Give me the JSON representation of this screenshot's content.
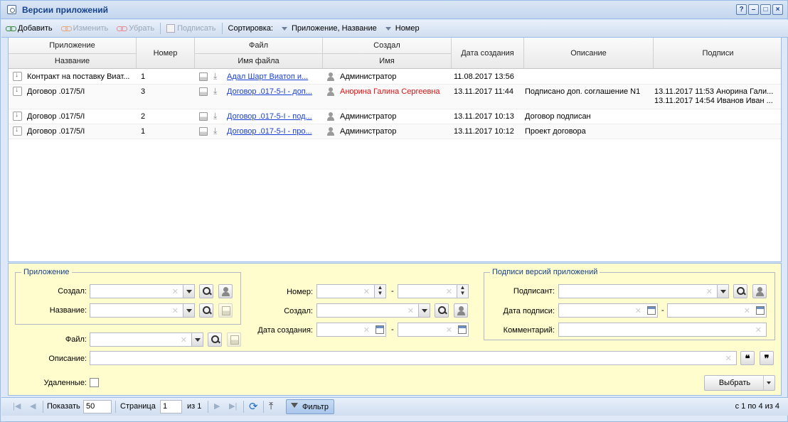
{
  "window": {
    "title": "Версии приложений",
    "controls": [
      "?",
      "–",
      "□",
      "×"
    ]
  },
  "toolbar": {
    "add": "Добавить",
    "edit": "Изменить",
    "remove": "Убрать",
    "sign": "Подписать",
    "sort_label": "Сортировка:",
    "sort1": "Приложение, Название",
    "sort2": "Номер"
  },
  "grid": {
    "headers": {
      "app": "Приложение",
      "app_name": "Название",
      "number": "Номер",
      "file": "Файл",
      "file_name": "Имя файла",
      "creator": "Создал",
      "creator_name": "Имя",
      "created_date": "Дата создания",
      "description": "Описание",
      "signatures": "Подписи"
    },
    "rows": [
      {
        "name": "Контракт на поставку Виат...",
        "number": "1",
        "file": "Адал Шарт Виатоп и...",
        "creator": "Администратор",
        "creator_red": false,
        "date": "11.08.2017 13:56",
        "description": "",
        "sig1": "",
        "sig2": ""
      },
      {
        "name": "Договор .017/5/I",
        "number": "3",
        "file": "Договор .017-5-I - доп...",
        "creator": "Анорина Галина Сергеевна",
        "creator_red": true,
        "date": "13.11.2017 11:44",
        "description": "Подписано доп. соглашение N1",
        "sig1": "13.11.2017 11:53 Анорина Гали...",
        "sig2": "13.11.2017 14:54 Иванов Иван ..."
      },
      {
        "name": "Договор .017/5/I",
        "number": "2",
        "file": "Договор .017-5-I - под...",
        "creator": "Администратор",
        "creator_red": false,
        "date": "13.11.2017 10:13",
        "description": "Договор подписан",
        "sig1": "",
        "sig2": ""
      },
      {
        "name": "Договор .017/5/I",
        "number": "1",
        "file": "Договор .017-5-I - про...",
        "creator": "Администратор",
        "creator_red": false,
        "date": "13.11.2017 10:12",
        "description": "Проект договора",
        "sig1": "",
        "sig2": ""
      }
    ]
  },
  "filter": {
    "app_group": "Приложение",
    "created_by": "Создал:",
    "name": "Название:",
    "file": "Файл:",
    "description": "Описание:",
    "deleted": "Удаленные:",
    "number": "Номер:",
    "created_by2": "Создал:",
    "created_date": "Дата создания:",
    "range_dash": "-",
    "sig_group": "Подписи версий приложений",
    "signer": "Подписант:",
    "sign_date": "Дата подписи:",
    "comment": "Комментарий:",
    "select_button": "Выбрать",
    "quote_open": "❝",
    "quote_close": "❞"
  },
  "pager": {
    "show_label": "Показать",
    "page_size": "50",
    "page_label": "Страница",
    "page": "1",
    "of": "из 1",
    "filter_button": "Фильтр",
    "summary": "с 1 по 4 из 4"
  },
  "colors": {
    "accent": "#15428b",
    "filter_bg": "#fffccd",
    "red_text": "#dd1111",
    "link": "#1a3fd6"
  }
}
